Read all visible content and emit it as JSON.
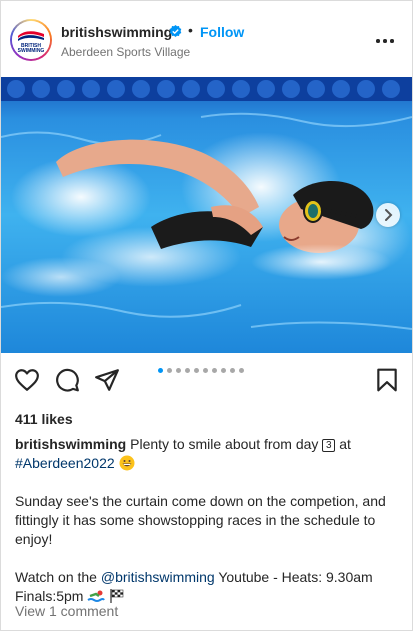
{
  "header": {
    "username": "britishswimming",
    "separator": "•",
    "follow_label": "Follow",
    "location": "Aberdeen Sports Village",
    "avatar_text_line1": "BRITISH",
    "avatar_text_line2": "SWIMMING"
  },
  "post": {
    "image_count": 10,
    "active_image_index": 0
  },
  "actions": {
    "like_icon": "heart-icon",
    "comment_icon": "comment-icon",
    "share_icon": "paper-plane-icon",
    "save_icon": "bookmark-icon"
  },
  "likes": "411 likes",
  "caption": {
    "username": "britishswimming",
    "text_part1": "Plenty to smile about from day",
    "day_number": "3",
    "text_part2": "at",
    "hashtag": "#Aberdeen2022",
    "paragraph2": "Sunday see's the curtain come down on the competion, and fittingly it has some showstopping races in the schedule to enjoy!",
    "paragraph3_part1": "Watch on the",
    "mention": "@britishswimming",
    "paragraph3_part2": "Youtube - Heats: 9.30am Finals:5pm"
  },
  "view_comments": "View 1 comment",
  "colors": {
    "accent": "#0095f6",
    "hashtag": "#00376b",
    "muted": "#737373"
  }
}
